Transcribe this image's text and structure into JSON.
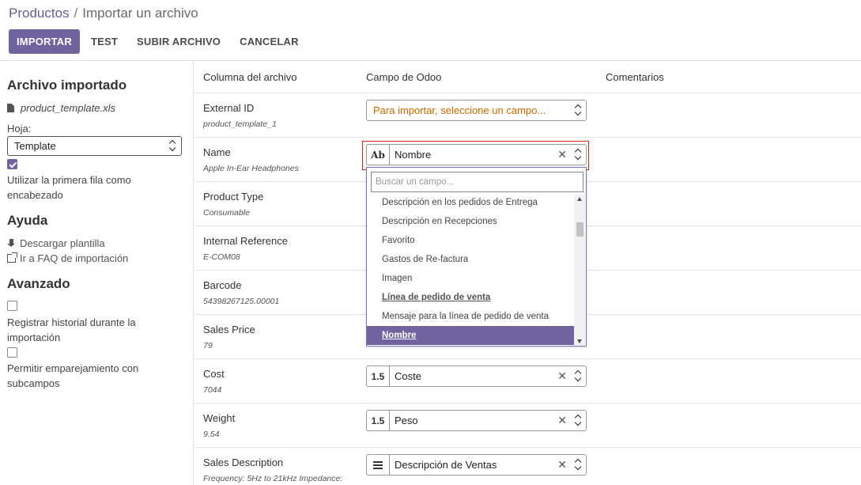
{
  "breadcrumb": {
    "parent": "Productos",
    "separator": "/",
    "current": "Importar un archivo"
  },
  "toolbar": {
    "import": "IMPORTAR",
    "test": "TEST",
    "upload": "SUBIR ARCHIVO",
    "cancel": "CANCELAR"
  },
  "sidebar": {
    "imported_file_title": "Archivo importado",
    "file_name": "product_template.xls",
    "sheet_label": "Hoja:",
    "sheet_value": "Template",
    "first_row_header_label": "Utilizar la primera fila como encabezado",
    "first_row_header_checked": true,
    "help_title": "Ayuda",
    "download_template": "Descargar plantilla",
    "faq_link": "Ir a FAQ de importación",
    "advanced_title": "Avanzado",
    "track_history_label": "Registrar historial durante la importación",
    "allow_subfields_label": "Permitir emparejamiento con subcampos"
  },
  "table": {
    "headers": {
      "column": "Columna del archivo",
      "field": "Campo de Odoo",
      "comments": "Comentarios"
    },
    "rows": [
      {
        "name": "External ID",
        "sample": "product_template_1",
        "field": "Para importar, seleccione un campo...",
        "type_badge": "",
        "placeholder": true
      },
      {
        "name": "Name",
        "sample": "Apple In-Ear Headphones",
        "field": "Nombre",
        "type_badge": "Ab"
      },
      {
        "name": "Product Type",
        "sample": "Consumable",
        "field": "",
        "type_badge": ""
      },
      {
        "name": "Internal Reference",
        "sample": "E-COM08",
        "field": "",
        "type_badge": ""
      },
      {
        "name": "Barcode",
        "sample": "54398267125.00001",
        "field": "",
        "type_badge": ""
      },
      {
        "name": "Sales Price",
        "sample": "79",
        "field": "",
        "type_badge": ""
      },
      {
        "name": "Cost",
        "sample": "7044",
        "field": "Coste",
        "type_badge": "1.5"
      },
      {
        "name": "Weight",
        "sample": "9.54",
        "field": "Peso",
        "type_badge": "1.5"
      },
      {
        "name": "Sales Description",
        "sample": "Frequency: 5Hz to 21kHz Impedance:",
        "field": "Descripción de Ventas",
        "type_badge": "lines"
      }
    ]
  },
  "dropdown": {
    "search_placeholder": "Buscar un campo...",
    "items": [
      "Descripción en los pedidos de Entrega",
      "Descripción en Recepciones",
      "Favorito",
      "Gastos de Re-factura",
      "Imagen",
      "Línea de pedido de venta",
      "Mensaje para la línea de pedido de venta",
      "Nombre"
    ],
    "bold_item": "Línea de pedido de venta",
    "selected_item": "Nombre"
  },
  "colors": {
    "primary": "#71639e",
    "placeholder": "#c66a00",
    "highlight": "#dd2222"
  },
  "icons": [
    "file-icon",
    "download-icon",
    "external-link-icon",
    "checkbox-icon",
    "clear-icon",
    "updown-icon",
    "text-lines-icon"
  ]
}
